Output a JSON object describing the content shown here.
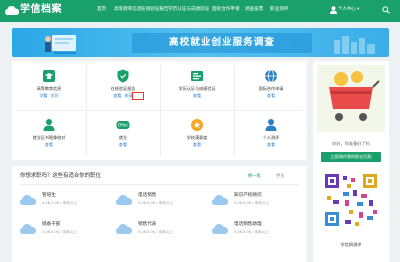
{
  "header": {
    "logo_text": "学信档案",
    "nav": [
      "首页",
      "高等教育信息",
      "在线验证报告",
      "学历认证与成绩验证",
      "国际合作申请",
      "调查投票",
      "职业测评"
    ],
    "user_menu": "个人中心 ▾",
    "colors": {
      "brand": "#1aa06a"
    }
  },
  "banner": {
    "title": "高校就业创业服务调查"
  },
  "services": [
    {
      "title": "高等教育信息",
      "links": [
        "学籍",
        "学历"
      ],
      "icon": "graduation-cap-icon",
      "color": "#1aa06a"
    },
    {
      "title": "在线验证报告",
      "links": [
        "查看",
        "申请"
      ],
      "icon": "shield-check-icon",
      "color": "#1aa06a"
    },
    {
      "title": "学历认证与成绩验证",
      "links": [
        "查看"
      ],
      "icon": "certificate-icon",
      "color": "#1aa06a"
    },
    {
      "title": "国际合作申请",
      "links": [
        "查看"
      ],
      "icon": "globe-icon",
      "color": "#2b7fc6"
    },
    {
      "title": "就业证书图像校对",
      "links": [
        "查看"
      ],
      "icon": "person-card-icon",
      "color": "#1aa06a"
    },
    {
      "title": "就业",
      "links": [
        "查看"
      ],
      "icon": "offer-icon",
      "color": "#1aa06a"
    },
    {
      "title": "学校满意度",
      "links": [
        "查看"
      ],
      "icon": "rating-icon",
      "color": "#f5a623"
    },
    {
      "title": "个人测评",
      "links": [
        "查看"
      ],
      "icon": "person-icon",
      "color": "#2b7fc6"
    }
  ],
  "jobs": {
    "title": "你想求职吗？这些有适合你的职位",
    "refresh": "换一批",
    "more": "更多",
    "items": [
      {
        "title": "管培生",
        "detail": "4.5K-7.0K / 本科以上"
      },
      {
        "title": "电话销售",
        "detail": "5.0K-5.0K / 本科以上"
      },
      {
        "title": "知识产权顾问",
        "detail": "5.0K-5.0K / 本科以上"
      },
      {
        "title": "储备干部",
        "detail": "5.0K-5.0K / 本科以上"
      },
      {
        "title": "销售代表",
        "detail": "5.0K-5.0K / 本科以上"
      },
      {
        "title": "电话销售助理",
        "detail": "5.0K-5.0K / 本科以上"
      }
    ]
  },
  "sidebar": {
    "promo_text": "你好，你准备好了吗",
    "promo_button": "立即测评我的职业匹配",
    "qr_label": "学信网测评"
  }
}
